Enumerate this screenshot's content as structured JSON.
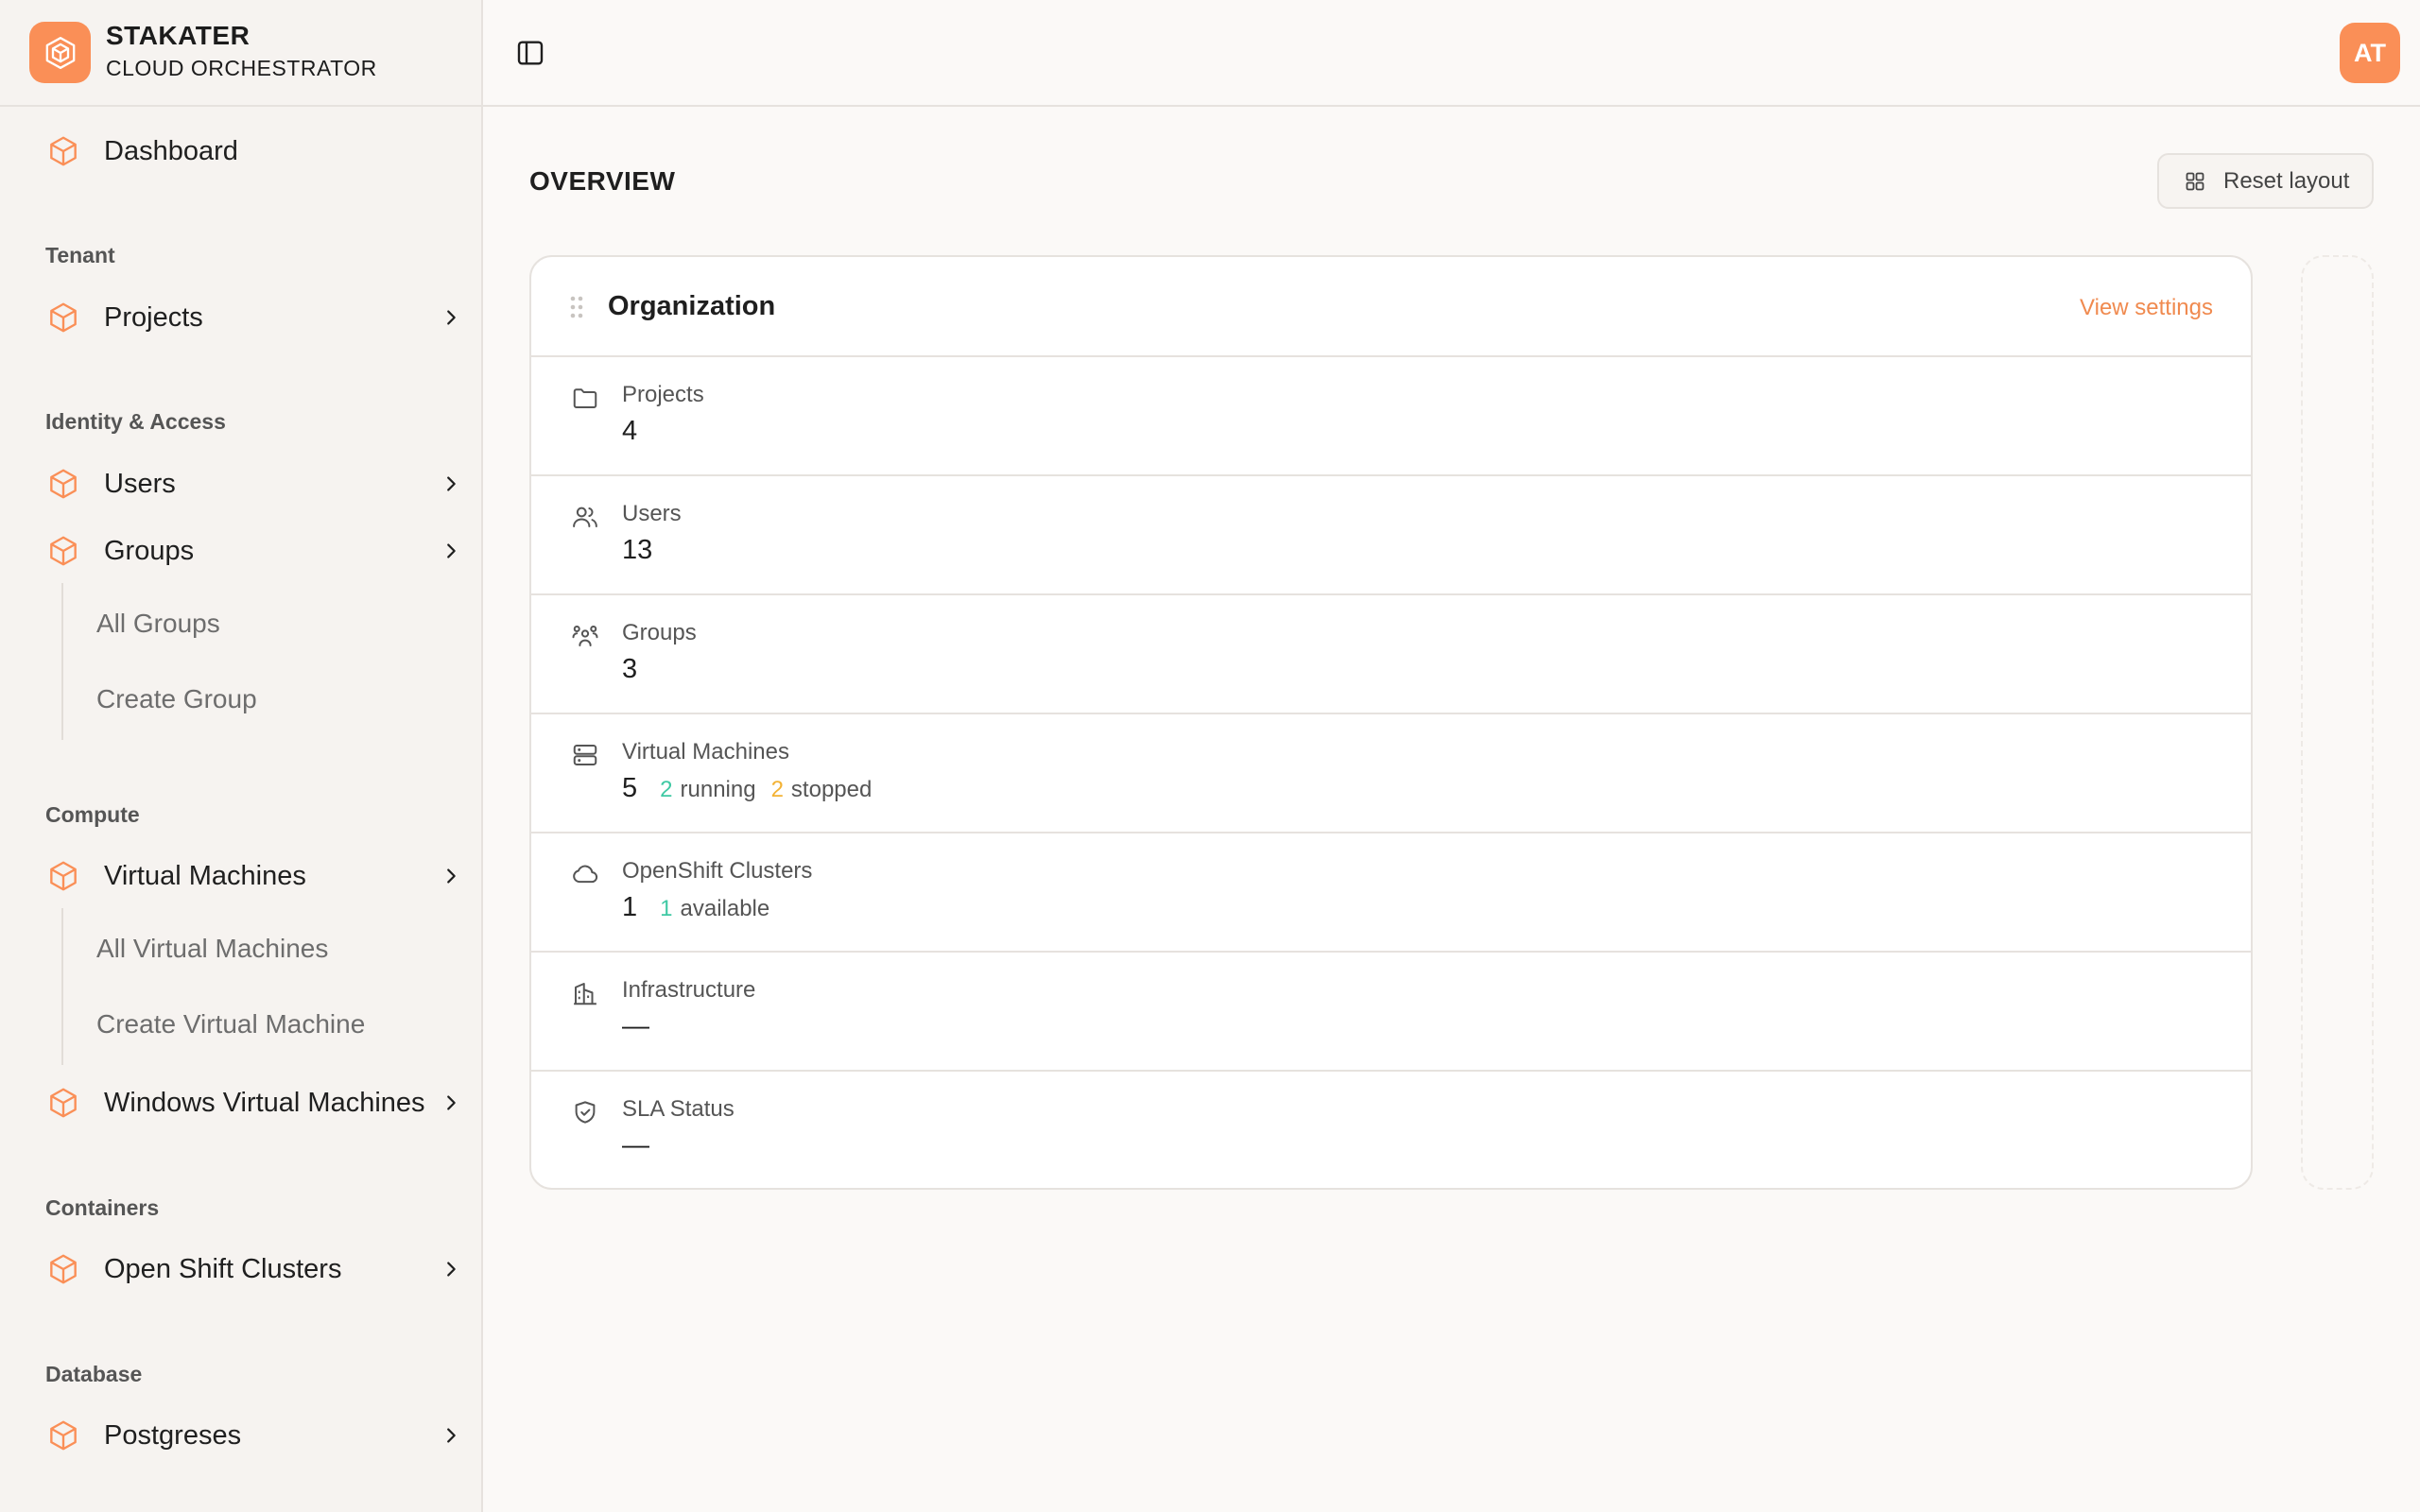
{
  "brand": {
    "name": "STAKATER",
    "subtitle": "CLOUD ORCHESTRATOR"
  },
  "topbar": {
    "avatar_initials": "AT"
  },
  "sidebar": {
    "dashboard": "Dashboard",
    "sections": {
      "tenant": "Tenant",
      "identity": "Identity & Access",
      "compute": "Compute",
      "containers": "Containers",
      "database": "Database"
    },
    "items": {
      "projects": "Projects",
      "users": "Users",
      "groups": "Groups",
      "virtual_machines": "Virtual Machines",
      "windows_vms": "Windows Virtual Machines",
      "openshift": "Open Shift Clusters",
      "postgreses": "Postgreses"
    },
    "groups_sub": [
      "All Groups",
      "Create Group"
    ],
    "vm_sub": [
      "All Virtual Machines",
      "Create Virtual Machine"
    ]
  },
  "main": {
    "title": "OVERVIEW",
    "reset_layout": "Reset layout",
    "card": {
      "title": "Organization",
      "link": "View settings",
      "rows": [
        {
          "label": "Projects",
          "value": "4"
        },
        {
          "label": "Users",
          "value": "13"
        },
        {
          "label": "Groups",
          "value": "3"
        },
        {
          "label": "Virtual Machines",
          "value": "5",
          "running_count": "2",
          "running_label": "running",
          "stopped_count": "2",
          "stopped_label": "stopped"
        },
        {
          "label": "OpenShift Clusters",
          "value": "1",
          "available_count": "1",
          "available_label": "available"
        },
        {
          "label": "Infrastructure",
          "value": "—"
        },
        {
          "label": "SLA Status",
          "value": "—"
        }
      ]
    }
  },
  "colors": {
    "accent": "#fa8f57",
    "link": "#f08a4f",
    "running": "#3fc9a4",
    "stopped": "#f3b234"
  }
}
